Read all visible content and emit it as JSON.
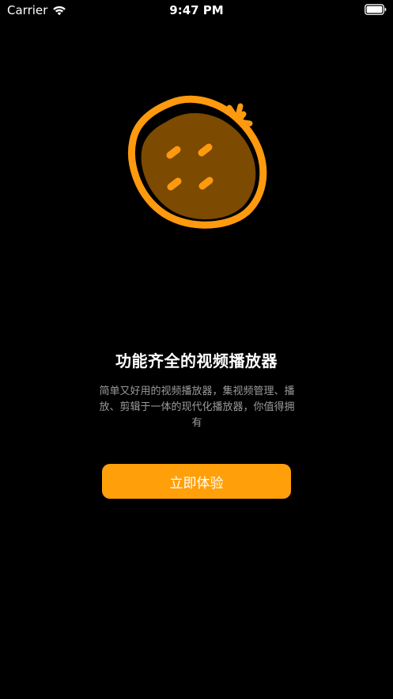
{
  "status_bar": {
    "carrier": "Carrier",
    "time": "9:47 PM",
    "wifi_icon": "wifi-icon",
    "battery_icon": "battery-icon"
  },
  "logo": {
    "icon": "strawberry-logo-icon",
    "colors": {
      "outline": "#ff9a0e",
      "fill": "#7c4a00",
      "seeds": "#ff9a0e"
    }
  },
  "onboarding": {
    "title": "功能齐全的视频播放器",
    "description": "简单又好用的视频播放器，集视频管理、播放、剪辑于一体的现代化播放器，你值得拥有",
    "cta_label": "立即体验"
  },
  "theme": {
    "background": "#000000",
    "accent": "#ffa00a",
    "title_color": "#ffffff",
    "description_color": "#9a9a9a"
  }
}
